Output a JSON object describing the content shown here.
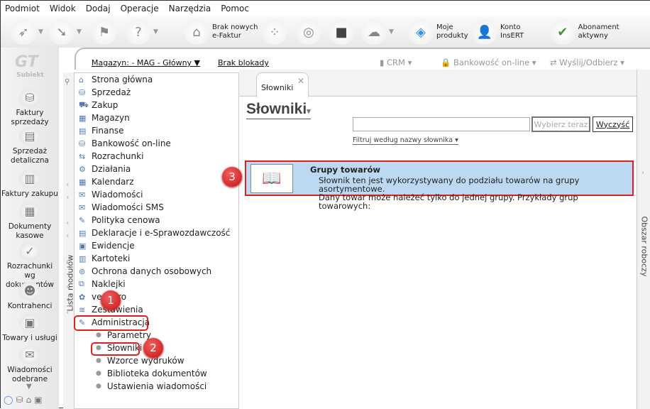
{
  "menu": [
    "Podmiot",
    "Widok",
    "Dodaj",
    "Operacje",
    "Narzędzia",
    "Pomoc"
  ],
  "toolbar": {
    "efaktur": [
      "Brak nowych",
      "e-Faktur"
    ],
    "produkty": [
      "Moje",
      "produkty"
    ],
    "konto": [
      "Konto",
      "InsERT"
    ],
    "abonament": "Abonament aktywny"
  },
  "logo": {
    "text": "GT",
    "sub": "Subiekt"
  },
  "leftbar": [
    [
      "Faktury",
      "sprzedaży"
    ],
    [
      "Sprzedaż",
      "detaliczna"
    ],
    [
      "Faktury zakupu",
      ""
    ],
    [
      "Dokumenty",
      "kasowe"
    ],
    [
      "Rozrachunki wg",
      "dokumentów"
    ],
    [
      "Kontrahenci",
      ""
    ],
    [
      "Towary i usługi",
      ""
    ],
    [
      "Wiadomości",
      "odebrane"
    ]
  ],
  "strip": {
    "magazyn": "Magazyn: - MAG - Główny",
    "blokady": "Brak blokady",
    "crm": "CRM",
    "bank": "Bankowość on-line",
    "wyslij": "Wyślij/Odbierz"
  },
  "modules_tab": "Lista modułów",
  "modules": [
    "Strona główna",
    "Sprzedaż",
    "Zakup",
    "Magazyn",
    "Finanse",
    "Bankowość on-line",
    "Rozrachunki",
    "Działania",
    "Kalendarz",
    "Wiadomości",
    "Wiadomości SMS",
    "Polityka cenowa",
    "Deklaracje i e-Sprawozdawczość",
    "Ewidencje",
    "Kartoteki",
    "Ochrona danych osobowych",
    "Naklejki",
    "vendero",
    "Zestawienia",
    "Administracja"
  ],
  "submodules": [
    "Parametry",
    "Słowniki",
    "Wzorce wydruków",
    "Biblioteka dokumentów",
    "Ustawienia wiadomości"
  ],
  "main": {
    "tab": "Słowniki",
    "title": "Słowniki",
    "search_value": "",
    "choose": "Wybierz teraz",
    "clear": "Wyczyść",
    "filter": "Filtruj według nazwy słownika",
    "item": {
      "title": "Grupy towarów",
      "desc1": "Słownik ten jest wykorzystywany do podziału towarów na grupy asortymentowe.",
      "desc2": "Dany towar może należeć tylko do jednej grupy. Przykłady grup towarowych:"
    }
  },
  "workspace_tab": "Obszar roboczy",
  "badges": [
    "1",
    "2",
    "3"
  ],
  "colors": {
    "highlight": "#e02020",
    "selected_row": "#bcd9f1"
  }
}
